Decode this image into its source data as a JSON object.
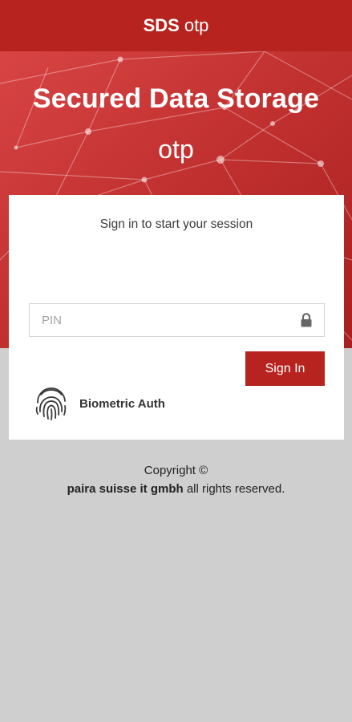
{
  "topbar": {
    "brand": "SDS",
    "suffix": "otp"
  },
  "hero": {
    "title": "Secured Data Storage",
    "subtitle": "otp"
  },
  "login": {
    "message": "Sign in to start your session",
    "pin_placeholder": "PIN",
    "pin_value": "",
    "signin_label": "Sign In",
    "biometric_label": "Biometric Auth"
  },
  "footer": {
    "copyright": "Copyright ©",
    "company": "paira suisse it gmbh",
    "rights": "all rights reserved."
  },
  "colors": {
    "brand_red": "#b7231e",
    "hero_red": "#c0302f",
    "page_bg": "#cfcfcf",
    "card_bg": "#ffffff"
  },
  "icons": [
    "lock-icon",
    "fingerprint-icon"
  ]
}
